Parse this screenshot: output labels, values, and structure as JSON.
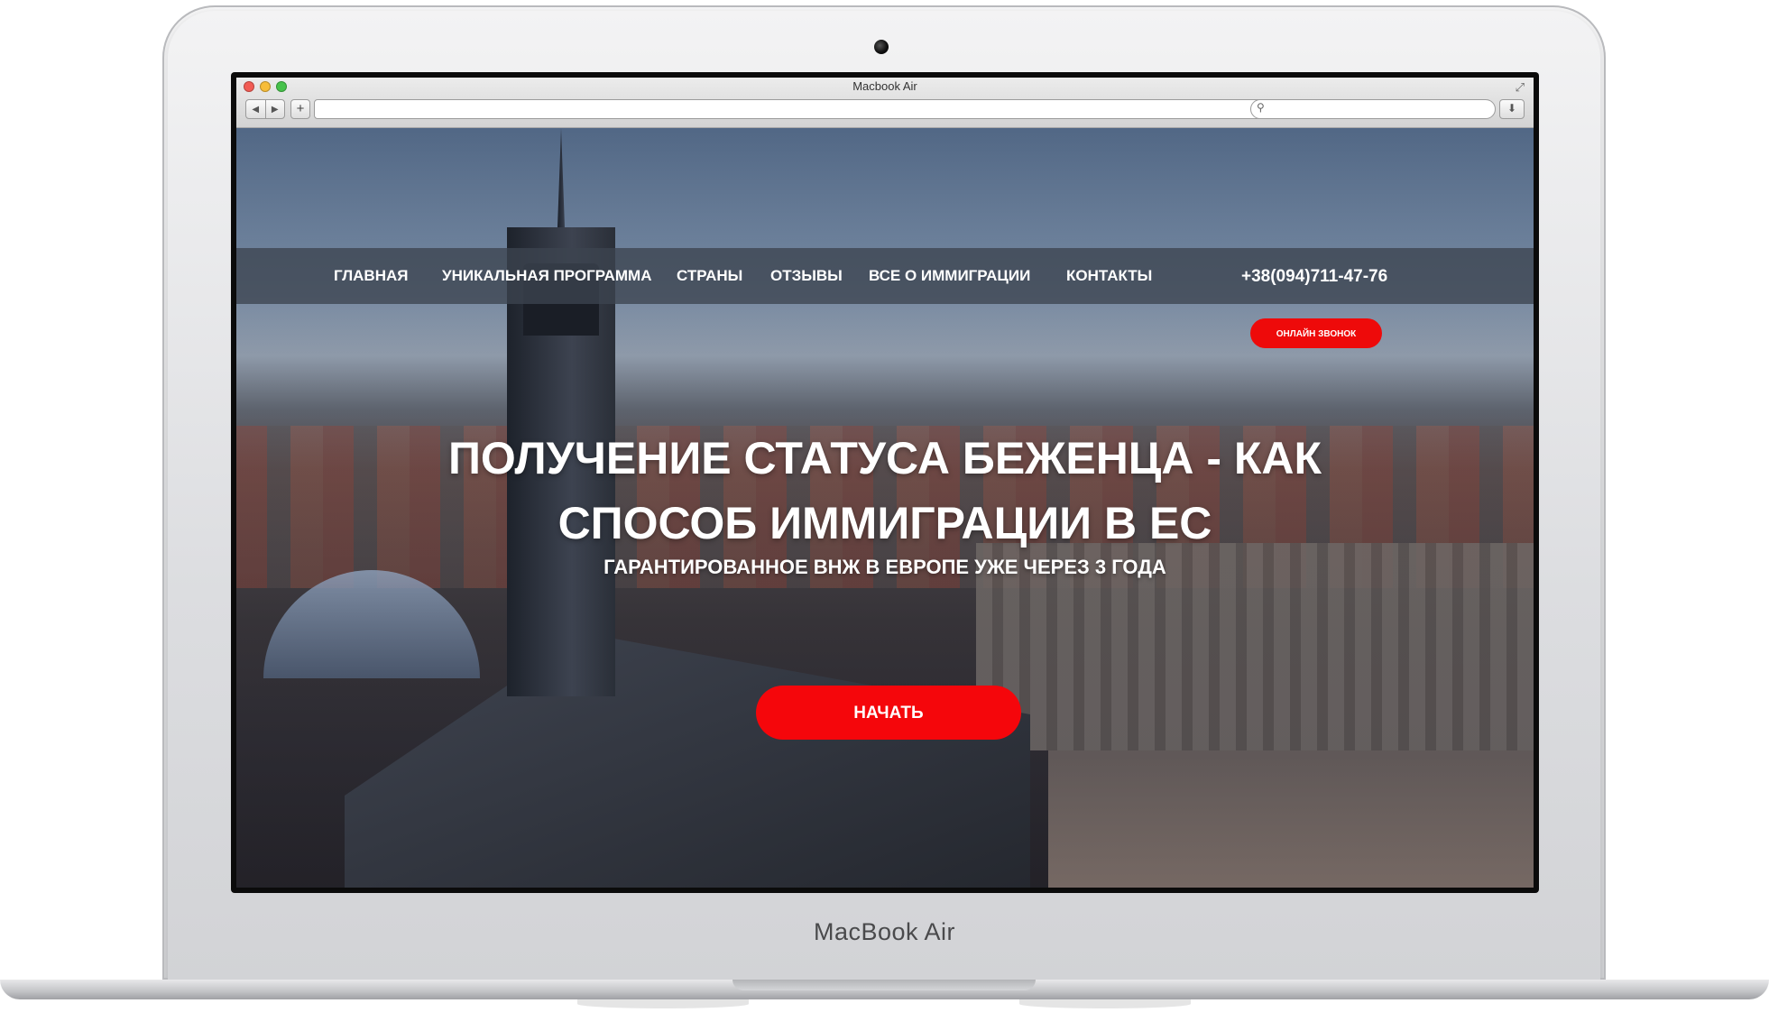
{
  "device": {
    "brand_label": "MacBook Air"
  },
  "browser": {
    "window_title": "Macbook Air",
    "back_icon": "triangle-left",
    "forward_icon": "triangle-right",
    "new_tab_label": "+",
    "url_value": "",
    "search_value": "",
    "reload_icon": "reload",
    "download_icon": "download",
    "fullscreen_icon": "fullscreen",
    "traffic_light_colors": [
      "#f25c54",
      "#f7bd3a",
      "#46c24a"
    ]
  },
  "site": {
    "nav": [
      {
        "label": "ГЛАВНАЯ"
      },
      {
        "label": "УНИКАЛЬНАЯ ПРОГРАММА"
      },
      {
        "label": "СТРАНЫ"
      },
      {
        "label": "ОТЗЫВЫ"
      },
      {
        "label": "ВСЕ О ИММИГРАЦИИ"
      },
      {
        "label": "КОНТАКТЫ"
      }
    ],
    "phone": "+38(094)711-47-76",
    "callback_label": "ОНЛАЙН ЗВОНОК",
    "hero": {
      "title_line1": "ПОЛУЧЕНИЕ СТАТУСА БЕЖЕНЦА - КАК",
      "title_line2": "СПОСОБ ИММИГРАЦИИ В ЕС",
      "subtitle": "ГАРАНТИРОВАННОЕ ВНЖ В ЕВРОПЕ УЖЕ ЧЕРЕЗ 3 ГОДА",
      "cta_label": "НАЧАТЬ"
    },
    "accent_color": "#ee0a0a"
  }
}
